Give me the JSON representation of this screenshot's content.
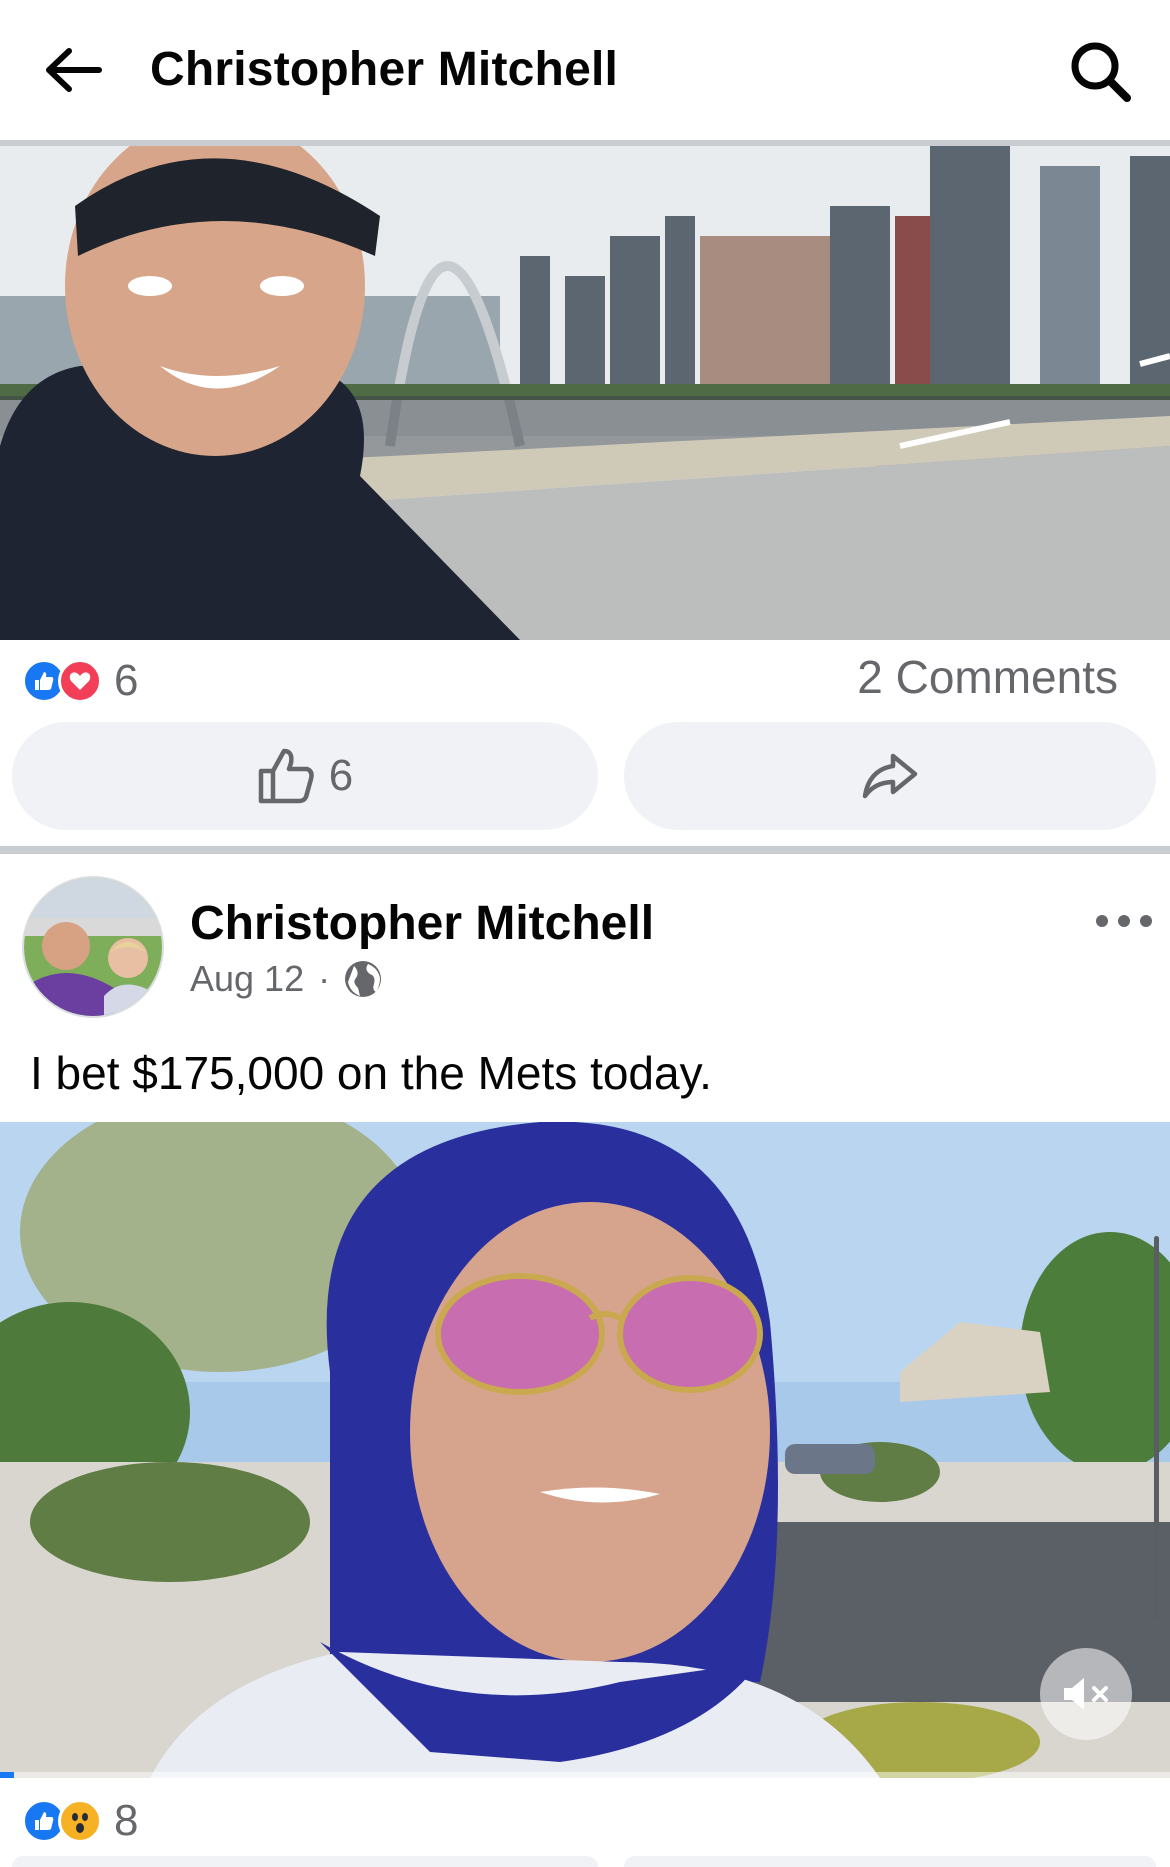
{
  "header": {
    "title": "Christopher Mitchell",
    "back_icon": "arrow-left-icon",
    "search_icon": "search-icon"
  },
  "post1": {
    "media_icon": "photo",
    "reactions": {
      "types": [
        "like",
        "love"
      ],
      "count": "6"
    },
    "comments": "2 Comments",
    "like_button_count": "6",
    "share_icon": "share-arrow-icon"
  },
  "post2": {
    "author": "Christopher Mitchell",
    "date": "Aug 12",
    "separator": "·",
    "audience_icon": "globe-icon",
    "more_icon": "more-horizontal-icon",
    "text": "I bet $175,000 on the Mets today.",
    "video": {
      "mute_icon": "speaker-muted-icon",
      "progress": 0.012
    },
    "reactions": {
      "types": [
        "like",
        "wow"
      ],
      "count": "8"
    }
  },
  "colors": {
    "brand": "#1877f2",
    "love": "#f33e58",
    "wow": "#f7b125",
    "muted_text": "#65676b",
    "pill": "#f0f2f5"
  }
}
